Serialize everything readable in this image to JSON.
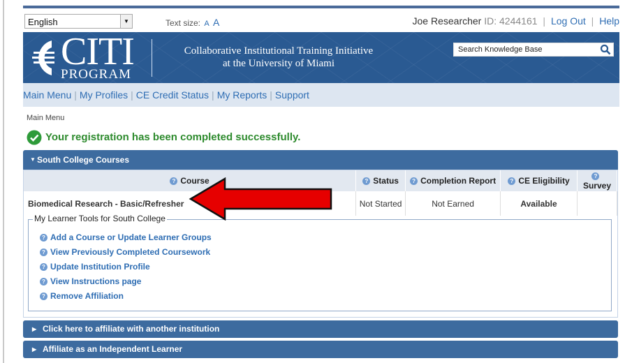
{
  "toolbar": {
    "language": "English",
    "text_size_label": "Text size:",
    "text_size_small": "A",
    "text_size_large": "A",
    "user_name": "Joe Researcher",
    "user_id": "ID: 4244161",
    "logout": "Log Out",
    "help": "Help"
  },
  "banner": {
    "logo_main": "CITI",
    "logo_sub": "PROGRAM",
    "institution_line1": "Collaborative Institutional Training Initiative",
    "institution_line2": "at the University of Miami",
    "search_placeholder": "Search Knowledge Base"
  },
  "nav": {
    "items": [
      "Main Menu",
      "My Profiles",
      "CE Credit Status",
      "My Reports",
      "Support"
    ]
  },
  "breadcrumb": "Main Menu",
  "success_message": "Your registration has been completed successfully.",
  "courses_panel": {
    "title": "South College Courses",
    "headers": [
      "Course",
      "Status",
      "Completion Report",
      "CE Eligibility",
      "Survey"
    ],
    "rows": [
      {
        "course": "Biomedical Research - Basic/Refresher",
        "status": "Not Started",
        "completion": "Not Earned",
        "ce": "Available",
        "survey": ""
      }
    ]
  },
  "tools": {
    "legend": "My Learner Tools for South College",
    "links": [
      "Add a Course or Update Learner Groups",
      "View Previously Completed Coursework",
      "Update Institution Profile",
      "View Instructions page",
      "Remove Affiliation"
    ]
  },
  "affiliate": {
    "other": "Click here to affiliate with another institution",
    "independent": "Affiliate as an Independent Learner"
  },
  "colors": {
    "banner": "#2a5a92",
    "panel_header": "#3d6b9f",
    "link": "#2e6db3",
    "success": "#2e8b2e",
    "arrow": "#e60000"
  }
}
